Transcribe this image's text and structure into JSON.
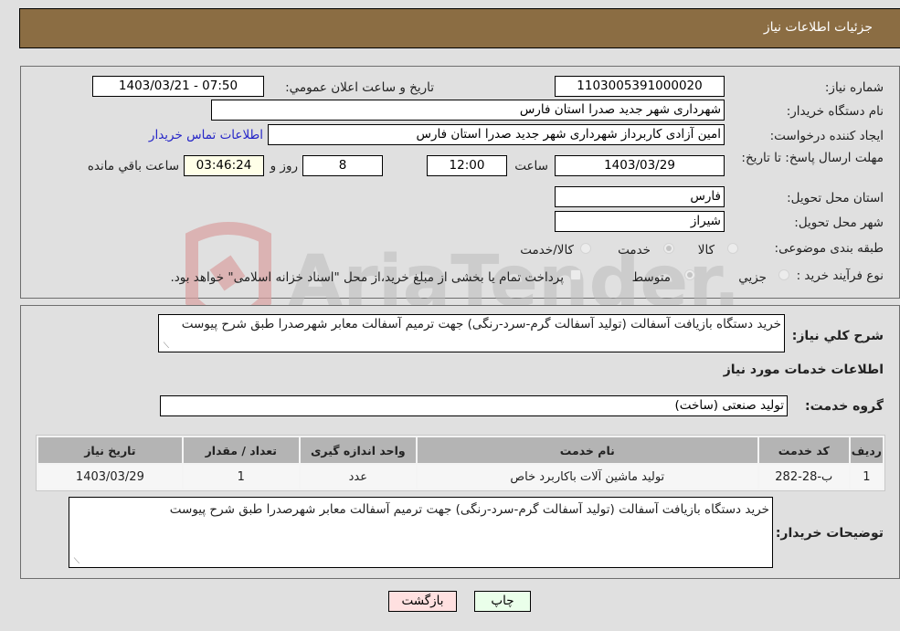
{
  "header": {
    "title": "جزئیات اطلاعات نیاز"
  },
  "form": {
    "need_number_label": "شماره نیاز:",
    "need_number": "1103005391000020",
    "announce_label": "تاریخ و ساعت اعلان عمومي:",
    "announce_value": "1403/03/21 - 07:50",
    "buyer_org_label": "نام دستگاه خریدار:",
    "buyer_org": "شهرداری شهر جدید صدرا استان فارس",
    "requester_label": "ایجاد کننده درخواست:",
    "requester": "امین آزادی کاربرداز شهرداری شهر جدید صدرا استان فارس",
    "contact_link": "اطلاعات تماس خریدار",
    "deadline_label": "مهلت ارسال پاسخ: تا تاریخ:",
    "deadline_date": "1403/03/29",
    "time_label": "ساعت",
    "deadline_time": "12:00",
    "days_value": "8",
    "days_label": "روز و",
    "remaining_time": "03:46:24",
    "remaining_label": "ساعت باقي مانده",
    "province_label": "استان محل تحویل:",
    "province": "فارس",
    "city_label": "شهر محل تحویل:",
    "city": "شیراز",
    "category_label": "طبقه بندی موضوعی:",
    "category_options": [
      {
        "label": "کالا",
        "selected": false
      },
      {
        "label": "خدمت",
        "selected": true
      },
      {
        "label": "کالا/خدمت",
        "selected": false
      }
    ],
    "purchase_type_label": "نوع فرآیند خرید :",
    "purchase_options": [
      {
        "label": "جزيي",
        "selected": false
      },
      {
        "label": "متوسط",
        "selected": true
      }
    ],
    "treasury_checkbox_label": "پرداخت تمام یا بخشی از مبلغ خرید،از محل \"اسناد خزانه اسلامی\" خواهد بود.",
    "treasury_checked": false
  },
  "summary": {
    "label": "شرح کلي نیاز:",
    "text": "خرید دستگاه بازیافت آسفالت (تولید آسفالت گرم-سرد-رنگی) جهت ترمیم آسفالت معابر شهرصدرا  طبق شرح پیوست"
  },
  "services": {
    "section_title": "اطلاعات خدمات مورد نیاز",
    "group_label": "گروه خدمت:",
    "group_value": "تولید صنعتی (ساخت)",
    "table": {
      "headers": [
        "ردیف",
        "کد خدمت",
        "نام خدمت",
        "واحد اندازه گیری",
        "تعداد / مقدار",
        "تاریخ نیاز"
      ],
      "rows": [
        [
          "1",
          "ب-28-282",
          "تولید ماشین آلات باکاربرد خاص",
          "عدد",
          "1",
          "1403/03/29"
        ]
      ]
    }
  },
  "buyer_notes": {
    "label": "توضیحات خریدار:",
    "text": "خرید دستگاه بازیافت آسفالت (تولید آسفالت گرم-سرد-رنگی) جهت ترمیم آسفالت معابر شهرصدرا  طبق شرح پیوست"
  },
  "buttons": {
    "print": "چاپ",
    "back": "بازگشت"
  },
  "colors": {
    "header_bg": "#8b6d43",
    "print_bg": "#eaffea",
    "back_bg": "#ffe0e0",
    "link": "#2626c8"
  }
}
